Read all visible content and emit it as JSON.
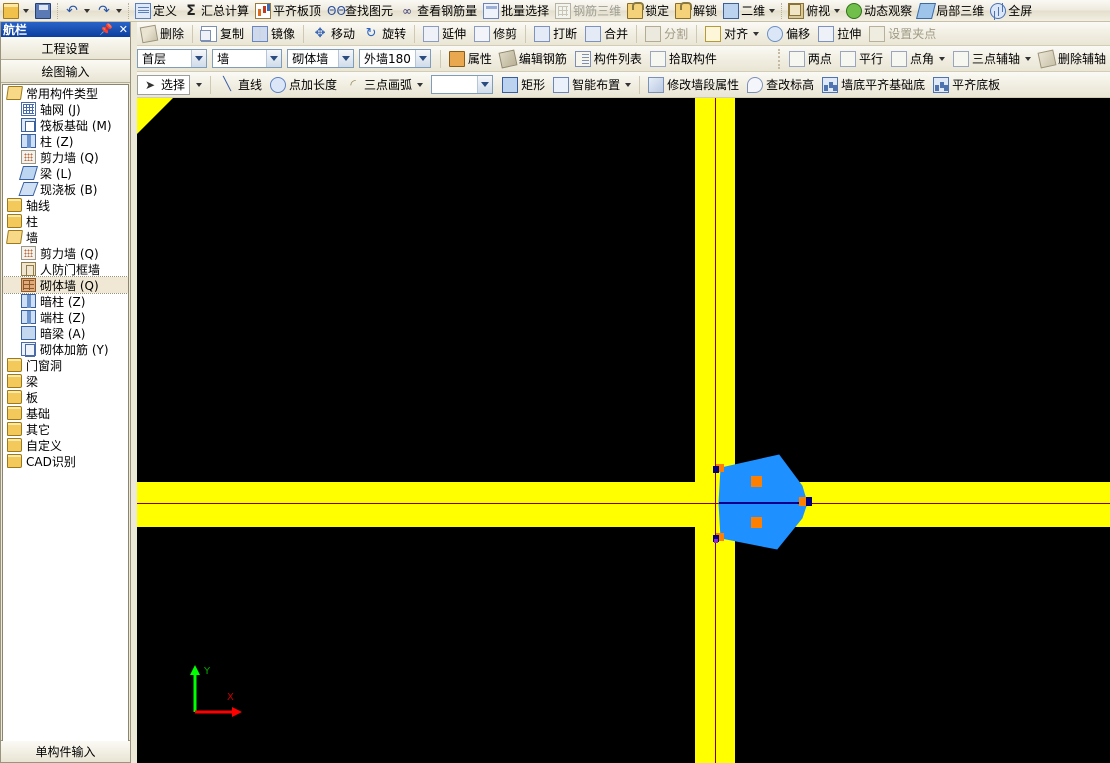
{
  "window": {
    "title": "导航栏"
  },
  "quick_bar": {
    "items": [
      {
        "name": "open-file-button",
        "label": "",
        "icon": "folder-icon",
        "dropdown": true,
        "disabled": false
      },
      {
        "name": "save-button",
        "label": "",
        "icon": "save-icon",
        "dropdown": false,
        "disabled": false
      },
      {
        "name": "undo-button",
        "label": "",
        "icon": "undo-icon",
        "dropdown": true,
        "disabled": false
      },
      {
        "name": "redo-button",
        "label": "",
        "icon": "redo-icon",
        "dropdown": true,
        "disabled": false
      },
      {
        "name": "define-button",
        "label": "定义",
        "icon": "define-icon",
        "dropdown": false,
        "disabled": false
      },
      {
        "name": "summary-calc-button",
        "label": "汇总计算",
        "icon": "sigma-icon",
        "dropdown": false,
        "disabled": false
      },
      {
        "name": "flush-slab-top-button",
        "label": "平齐板顶",
        "icon": "chart-icon",
        "dropdown": false,
        "disabled": false
      },
      {
        "name": "find-element-button",
        "label": "查找图元",
        "icon": "binoculars-icon",
        "dropdown": false,
        "disabled": false
      },
      {
        "name": "view-rebar-qty-button",
        "label": "查看钢筋量",
        "icon": "glasses-icon",
        "dropdown": false,
        "disabled": false
      },
      {
        "name": "batch-select-button",
        "label": "批量选择",
        "icon": "batch-select-icon",
        "dropdown": false,
        "disabled": false
      },
      {
        "name": "rebar-3d-button",
        "label": "钢筋三维",
        "icon": "grid-3d-icon",
        "dropdown": false,
        "disabled": true
      },
      {
        "name": "lock-button",
        "label": "锁定",
        "icon": "lock-icon",
        "dropdown": false,
        "disabled": false
      },
      {
        "name": "unlock-button",
        "label": "解锁",
        "icon": "unlock-icon",
        "dropdown": false,
        "disabled": false
      },
      {
        "name": "view-2d-button",
        "label": "二维",
        "icon": "two-d-icon",
        "dropdown": true,
        "disabled": false
      },
      {
        "name": "top-view-button",
        "label": "俯视",
        "icon": "cube-icon",
        "dropdown": true,
        "disabled": false
      },
      {
        "name": "dynamic-observe-button",
        "label": "动态观察",
        "icon": "orbit-icon",
        "dropdown": false,
        "disabled": false
      },
      {
        "name": "local-3d-button",
        "label": "局部三维",
        "icon": "local-3d-icon",
        "dropdown": false,
        "disabled": false
      },
      {
        "name": "fullscreen-button",
        "label": "全屏",
        "icon": "fullscreen-icon",
        "dropdown": false,
        "disabled": false
      }
    ]
  },
  "edit_toolbar": {
    "items": [
      {
        "name": "delete-button",
        "label": "删除",
        "icon": "eraser-icon",
        "disabled": false
      },
      {
        "name": "copy-button",
        "label": "复制",
        "icon": "copy-icon",
        "disabled": false
      },
      {
        "name": "mirror-button",
        "label": "镜像",
        "icon": "mirror-icon",
        "disabled": false
      },
      {
        "name": "move-button",
        "label": "移动",
        "icon": "move-icon",
        "disabled": false
      },
      {
        "name": "rotate-button",
        "label": "旋转",
        "icon": "rotate-icon",
        "disabled": false
      },
      {
        "name": "extend-button",
        "label": "延伸",
        "icon": "extend-icon",
        "disabled": false
      },
      {
        "name": "trim-button",
        "label": "修剪",
        "icon": "trim-icon",
        "disabled": false
      },
      {
        "name": "break-button",
        "label": "打断",
        "icon": "break-icon",
        "disabled": false
      },
      {
        "name": "merge-button",
        "label": "合并",
        "icon": "merge-icon",
        "disabled": false
      },
      {
        "name": "split-button",
        "label": "分割",
        "icon": "split-icon",
        "disabled": true
      },
      {
        "name": "align-button",
        "label": "对齐",
        "icon": "align-icon",
        "disabled": false,
        "dropdown": true
      },
      {
        "name": "offset-button",
        "label": "偏移",
        "icon": "offset-icon",
        "disabled": false
      },
      {
        "name": "stretch-button",
        "label": "拉伸",
        "icon": "stretch-icon",
        "disabled": false
      },
      {
        "name": "set-grip-button",
        "label": "设置夹点",
        "icon": "grip-icon",
        "disabled": true
      }
    ]
  },
  "property_toolbar": {
    "combos": [
      {
        "name": "floor-combo",
        "value": "首层",
        "width": 80
      },
      {
        "name": "category-combo",
        "value": "墙",
        "width": 80
      },
      {
        "name": "component-type-combo",
        "value": "砌体墙",
        "width": 76
      },
      {
        "name": "component-combo",
        "value": "外墙180",
        "width": 78
      }
    ],
    "items": [
      {
        "name": "properties-button",
        "label": "属性",
        "icon": "properties-icon",
        "disabled": false
      },
      {
        "name": "edit-rebar-button",
        "label": "编辑钢筋",
        "icon": "edit-rebar-icon",
        "disabled": false
      },
      {
        "name": "component-list-button",
        "label": "构件列表",
        "icon": "component-list-icon",
        "disabled": false
      },
      {
        "name": "pick-component-button",
        "label": "拾取构件",
        "icon": "pick-icon",
        "disabled": false
      }
    ],
    "axis_items": [
      {
        "name": "two-point-button",
        "label": "两点",
        "icon": "two-point-icon",
        "dropdown": false
      },
      {
        "name": "parallel-button",
        "label": "平行",
        "icon": "parallel-icon",
        "dropdown": false
      },
      {
        "name": "point-angle-button",
        "label": "点角",
        "icon": "point-angle-icon",
        "dropdown": true
      },
      {
        "name": "three-point-axis-button",
        "label": "三点辅轴",
        "icon": "three-point-axis-icon",
        "dropdown": true
      },
      {
        "name": "delete-aux-axis-button",
        "label": "删除辅轴",
        "icon": "delete-axis-icon",
        "dropdown": false
      }
    ]
  },
  "draw_toolbar": {
    "select": {
      "name": "select-button",
      "label": "选择",
      "icon": "cursor-icon",
      "pressed": true,
      "dropdown": true
    },
    "items": [
      {
        "name": "line-button",
        "label": "直线",
        "icon": "line-icon",
        "dropdown": false
      },
      {
        "name": "point-add-length-button",
        "label": "点加长度",
        "icon": "point-length-icon",
        "dropdown": false
      },
      {
        "name": "three-point-arc-button",
        "label": "三点画弧",
        "icon": "arc-icon",
        "dropdown": true
      }
    ],
    "blank_combo": {
      "name": "arc-option-combo",
      "value": "",
      "width": 62
    },
    "items2": [
      {
        "name": "rectangle-button",
        "label": "矩形",
        "icon": "rectangle-icon",
        "dropdown": false
      },
      {
        "name": "smart-layout-button",
        "label": "智能布置",
        "icon": "smart-layout-icon",
        "dropdown": true
      },
      {
        "name": "modify-wall-segment-button",
        "label": "修改墙段属性",
        "icon": "wall-property-icon",
        "dropdown": false
      },
      {
        "name": "check-elevation-button",
        "label": "查改标高",
        "icon": "elevation-icon",
        "dropdown": false
      },
      {
        "name": "wall-bottom-flush-foundation-button",
        "label": "墙底平齐基础底",
        "icon": "building-icon",
        "dropdown": false
      },
      {
        "name": "flush-bottom-slab-button",
        "label": "平齐底板",
        "icon": "building-icon",
        "dropdown": false
      }
    ]
  },
  "nav_panel": {
    "title": "航栏",
    "pin_icon": "pin-icon",
    "close_icon": "close-icon",
    "groups": [
      {
        "name": "project-settings-group",
        "label": "工程设置"
      },
      {
        "name": "drawing-input-group",
        "label": "绘图输入"
      }
    ],
    "footer": {
      "name": "single-component-input-group",
      "label": "单构件输入"
    },
    "tree": [
      {
        "label": "常用构件类型",
        "level": 1,
        "icon": "folder-open-icon",
        "selected": false
      },
      {
        "label": "轴网 (J)",
        "level": 2,
        "icon": "axis-grid-icon",
        "selected": false
      },
      {
        "label": "筏板基础 (M)",
        "level": 2,
        "icon": "raft-foundation-icon",
        "selected": false
      },
      {
        "label": "柱 (Z)",
        "level": 2,
        "icon": "column-icon",
        "selected": false
      },
      {
        "label": "剪力墙 (Q)",
        "level": 2,
        "icon": "shear-wall-icon",
        "selected": false
      },
      {
        "label": "梁 (L)",
        "level": 2,
        "icon": "beam-icon",
        "selected": false
      },
      {
        "label": "现浇板 (B)",
        "level": 2,
        "icon": "slab-icon",
        "selected": false
      },
      {
        "label": "轴线",
        "level": 1,
        "icon": "folder-closed-icon",
        "selected": false
      },
      {
        "label": "柱",
        "level": 1,
        "icon": "folder-closed-icon",
        "selected": false
      },
      {
        "label": "墙",
        "level": 1,
        "icon": "folder-open-icon",
        "selected": false
      },
      {
        "label": "剪力墙 (Q)",
        "level": 2,
        "icon": "shear-wall-icon",
        "selected": false
      },
      {
        "label": "人防门框墙",
        "level": 2,
        "icon": "door-frame-wall-icon",
        "selected": false
      },
      {
        "label": "砌体墙 (Q)",
        "level": 2,
        "icon": "masonry-wall-icon",
        "selected": true
      },
      {
        "label": "暗柱 (Z)",
        "level": 2,
        "icon": "hidden-column-icon",
        "selected": false
      },
      {
        "label": "端柱 (Z)",
        "level": 2,
        "icon": "end-column-icon",
        "selected": false
      },
      {
        "label": "暗梁 (A)",
        "level": 2,
        "icon": "hidden-beam-icon",
        "selected": false
      },
      {
        "label": "砌体加筋 (Y)",
        "level": 2,
        "icon": "masonry-reinforcement-icon",
        "selected": false
      },
      {
        "label": "门窗洞",
        "level": 1,
        "icon": "folder-closed-icon",
        "selected": false
      },
      {
        "label": "梁",
        "level": 1,
        "icon": "folder-closed-icon",
        "selected": false
      },
      {
        "label": "板",
        "level": 1,
        "icon": "folder-closed-icon",
        "selected": false
      },
      {
        "label": "基础",
        "level": 1,
        "icon": "folder-closed-icon",
        "selected": false
      },
      {
        "label": "其它",
        "level": 1,
        "icon": "folder-closed-icon",
        "selected": false
      },
      {
        "label": "自定义",
        "level": 1,
        "icon": "folder-closed-icon",
        "selected": false
      },
      {
        "label": "CAD识别",
        "level": 1,
        "icon": "folder-closed-icon",
        "selected": false
      }
    ]
  },
  "canvas": {
    "background_color": "#000000",
    "wall_color": "#ffff00",
    "axis_line_color": "#8b0000",
    "selection_fill_color": "#1e90ff",
    "selection_grip_color": "#ff7f00",
    "axis_indicator": {
      "x_label": "X",
      "x_color": "#ff0000",
      "y_label": "Y",
      "y_color": "#00ff00"
    }
  }
}
